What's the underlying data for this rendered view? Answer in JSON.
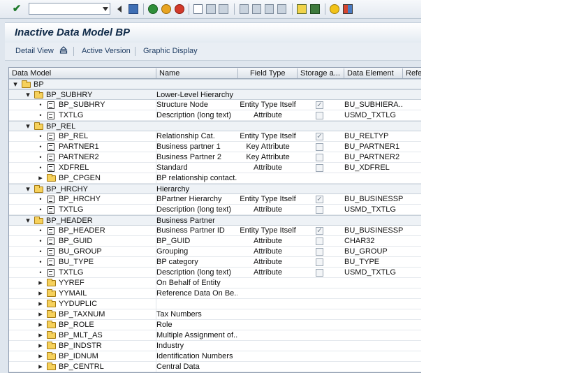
{
  "toolbar": {
    "command_field_value": "",
    "icons": [
      "enter-icon",
      "back-icon",
      "save-icon",
      "back-nav-icon",
      "exit-icon",
      "cancel-icon",
      "print-icon",
      "find-icon",
      "find-next-icon",
      "first-page-icon",
      "previous-page-icon",
      "next-page-icon",
      "last-page-icon",
      "create-session-icon",
      "shortcut-icon",
      "help-icon",
      "customize-layout-icon"
    ]
  },
  "title": "Inactive Data Model BP",
  "app_toolbar": {
    "detail_view": "Detail View",
    "active_version": "Active Version",
    "graphic_display": "Graphic Display"
  },
  "columns": {
    "data_model": "Data Model",
    "name": "Name",
    "field_type": "Field Type",
    "storage": "Storage a...",
    "data_element": "Data Element",
    "reference": "Refe"
  },
  "rows": [
    {
      "label": "BP",
      "type": "folder",
      "toggle": "open",
      "name": "",
      "field_type": "",
      "storage": "none",
      "data_element": ""
    },
    {
      "label": "BP_SUBHRY",
      "type": "folder",
      "toggle": "open",
      "name": "Lower-Level Hierarchy",
      "field_type": "",
      "storage": "none",
      "data_element": ""
    },
    {
      "label": "BP_SUBHRY",
      "type": "field",
      "toggle": "bullet",
      "name": "Structure Node",
      "field_type": "Entity Type Itself",
      "storage": "checked",
      "data_element": "BU_SUBHIERA..."
    },
    {
      "label": "TXTLG",
      "type": "field",
      "toggle": "bullet",
      "name": "Description (long text)",
      "field_type": "Attribute",
      "storage": "unchecked",
      "data_element": "USMD_TXTLG"
    },
    {
      "label": "BP_REL",
      "type": "folder",
      "toggle": "open",
      "name": "",
      "field_type": "",
      "storage": "none",
      "data_element": ""
    },
    {
      "label": "BP_REL",
      "type": "field",
      "toggle": "bullet",
      "name": "Relationship Cat.",
      "field_type": "Entity Type Itself",
      "storage": "checked",
      "data_element": "BU_RELTYP"
    },
    {
      "label": "PARTNER1",
      "type": "field",
      "toggle": "bullet",
      "name": "Business partner 1",
      "field_type": "Key Attribute",
      "storage": "unchecked",
      "data_element": "BU_PARTNER1"
    },
    {
      "label": "PARTNER2",
      "type": "field",
      "toggle": "bullet",
      "name": "Business Partner 2",
      "field_type": "Key Attribute",
      "storage": "unchecked",
      "data_element": "BU_PARTNER2"
    },
    {
      "label": "XDFREL",
      "type": "field",
      "toggle": "bullet",
      "name": "Standard",
      "field_type": "Attribute",
      "storage": "unchecked",
      "data_element": "BU_XDFREL"
    },
    {
      "label": "BP_CPGEN",
      "type": "folder",
      "toggle": "closed",
      "name": "BP relationship contact...",
      "field_type": "",
      "storage": "none",
      "data_element": ""
    },
    {
      "label": "BP_HRCHY",
      "type": "folder",
      "toggle": "open",
      "name": "Hierarchy",
      "field_type": "",
      "storage": "none",
      "data_element": ""
    },
    {
      "label": "BP_HRCHY",
      "type": "field",
      "toggle": "bullet",
      "name": "BPartner Hierarchy",
      "field_type": "Entity Type Itself",
      "storage": "checked",
      "data_element": "BU_BUSINESSP..."
    },
    {
      "label": "TXTLG",
      "type": "field",
      "toggle": "bullet",
      "name": "Description (long text)",
      "field_type": "Attribute",
      "storage": "unchecked",
      "data_element": "USMD_TXTLG"
    },
    {
      "label": "BP_HEADER",
      "type": "folder",
      "toggle": "open",
      "name": "Business Partner",
      "field_type": "",
      "storage": "none",
      "data_element": ""
    },
    {
      "label": "BP_HEADER",
      "type": "field",
      "toggle": "bullet",
      "name": "Business Partner ID",
      "field_type": "Entity Type Itself",
      "storage": "checked",
      "data_element": "BU_BUSINESSP..."
    },
    {
      "label": "BP_GUID",
      "type": "field",
      "toggle": "bullet",
      "name": "BP_GUID",
      "field_type": "Attribute",
      "storage": "unchecked",
      "data_element": "CHAR32"
    },
    {
      "label": "BU_GROUP",
      "type": "field",
      "toggle": "bullet",
      "name": "Grouping",
      "field_type": "Attribute",
      "storage": "unchecked",
      "data_element": "BU_GROUP"
    },
    {
      "label": "BU_TYPE",
      "type": "field",
      "toggle": "bullet",
      "name": "BP category",
      "field_type": "Attribute",
      "storage": "unchecked",
      "data_element": "BU_TYPE"
    },
    {
      "label": "TXTLG",
      "type": "field",
      "toggle": "bullet",
      "name": "Description (long text)",
      "field_type": "Attribute",
      "storage": "unchecked",
      "data_element": "USMD_TXTLG"
    },
    {
      "label": "YYREF",
      "type": "folder",
      "toggle": "closed",
      "name": "On Behalf of Entity",
      "field_type": "",
      "storage": "none",
      "data_element": ""
    },
    {
      "label": "YYMAIL",
      "type": "folder",
      "toggle": "closed",
      "name": "Reference Data On Be...",
      "field_type": "",
      "storage": "none",
      "data_element": ""
    },
    {
      "label": "YYDUPLIC",
      "type": "folder",
      "toggle": "closed",
      "name": "",
      "field_type": "",
      "storage": "none",
      "data_element": ""
    },
    {
      "label": "BP_TAXNUM",
      "type": "folder",
      "toggle": "closed",
      "name": "Tax Numbers",
      "field_type": "",
      "storage": "none",
      "data_element": ""
    },
    {
      "label": "BP_ROLE",
      "type": "folder",
      "toggle": "closed",
      "name": "Role",
      "field_type": "",
      "storage": "none",
      "data_element": ""
    },
    {
      "label": "BP_MLT_AS",
      "type": "folder",
      "toggle": "closed",
      "name": "Multiple Assignment of...",
      "field_type": "",
      "storage": "none",
      "data_element": ""
    },
    {
      "label": "BP_INDSTR",
      "type": "folder",
      "toggle": "closed",
      "name": "Industry",
      "field_type": "",
      "storage": "none",
      "data_element": ""
    },
    {
      "label": "BP_IDNUM",
      "type": "folder",
      "toggle": "closed",
      "name": "Identification Numbers",
      "field_type": "",
      "storage": "none",
      "data_element": ""
    },
    {
      "label": "BP_CENTRL",
      "type": "folder",
      "toggle": "closed",
      "name": "Central Data",
      "field_type": "",
      "storage": "none",
      "data_element": ""
    }
  ]
}
